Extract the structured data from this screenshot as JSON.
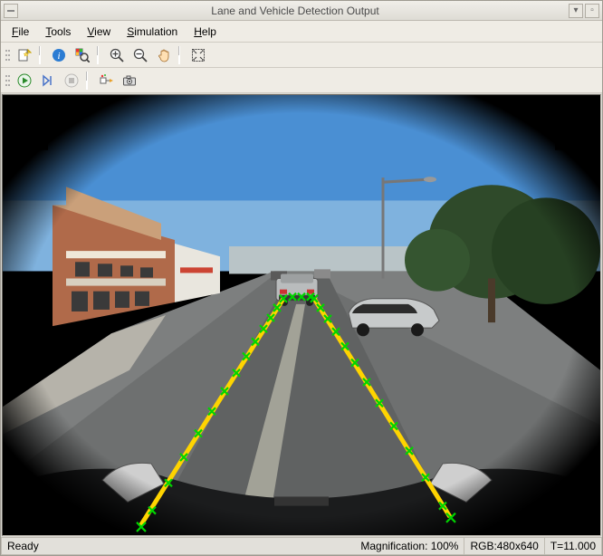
{
  "window": {
    "title": "Lane and Vehicle Detection Output"
  },
  "menu": {
    "file": "File",
    "tools": "Tools",
    "view": "View",
    "simulation": "Simulation",
    "help": "Help"
  },
  "toolbar1": {
    "new_figure": "new-figure",
    "inspect": "inspect",
    "link_axes": "link-axes",
    "zoom_in": "zoom-in",
    "zoom_out": "zoom-out",
    "pan": "pan",
    "fit": "fit-to-view"
  },
  "toolbar2": {
    "run": "run",
    "step": "step",
    "stop": "stop",
    "highlight": "highlight-block",
    "snapshot": "snapshot"
  },
  "status": {
    "state": "Ready",
    "magnification_label": "Magnification:",
    "magnification_value": "100%",
    "rgb_label": "RGB:",
    "rgb_value": "480x640",
    "time_label": "T=",
    "time_value": "11.000"
  },
  "overlay": {
    "left_lane_color": "#ffd400",
    "right_lane_color": "#ffd400",
    "marker_color": "#00e000",
    "vehicle_box_color": "#00e000"
  }
}
